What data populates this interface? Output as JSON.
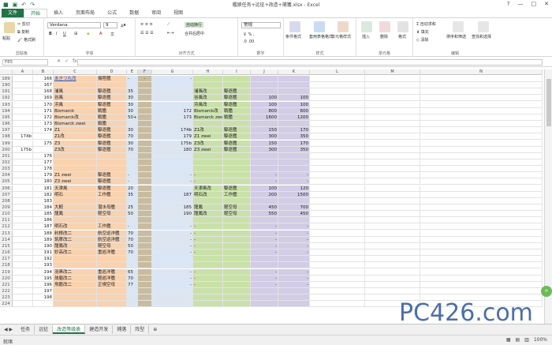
{
  "app": {
    "title": "艦娘任务+远征+改造+捕獲.xlsx - Excel"
  },
  "tabs": [
    "文件",
    "开始",
    "插入",
    "页面布局",
    "公式",
    "数据",
    "审阅",
    "视图"
  ],
  "ribbon": {
    "clipboard": {
      "paste": "粘贴",
      "cut": "剪切",
      "copy": "复制",
      "painter": "格式刷",
      "label": "剪贴板"
    },
    "font": {
      "name": "Verdana",
      "size": "9",
      "label": "字体"
    },
    "align": {
      "wrap": "自动换行",
      "merge": "合并后居中",
      "label": "对齐方式"
    },
    "number": {
      "format": "常规",
      "label": "数字"
    },
    "styles": {
      "cond": "条件格式",
      "table": "套用表格格式",
      "cell": "单元格样式",
      "label": "样式"
    },
    "cells": {
      "insert": "插入",
      "delete": "删除",
      "format": "格式",
      "label": "单元格"
    },
    "edit": {
      "autosum": "自动求和",
      "fill": "填充",
      "clear": "清除",
      "sort": "排序和筛选",
      "find": "查找和选择",
      "label": "编辑"
    }
  },
  "formula": {
    "namebox": "F85",
    "fx": "fx"
  },
  "columns": [
    "",
    "A",
    "B",
    "C",
    "D",
    "E",
    "F",
    "G",
    "H",
    "I",
    "J",
    "K",
    "L",
    "M",
    "N"
  ],
  "rows": [
    {
      "n": "189",
      "a": "",
      "b": "166",
      "c": "あきつ丸改",
      "d": "揚陸艦",
      "e": "-",
      "f": "-",
      "g": "-",
      "h": "",
      "i": "",
      "j": "",
      "k": "",
      "link": true
    },
    {
      "n": "190",
      "a": "",
      "b": "167",
      "c": "",
      "d": "",
      "e": "",
      "f": "",
      "g": "",
      "h": "",
      "i": "",
      "j": "",
      "k": ""
    },
    {
      "n": "191",
      "a": "",
      "b": "168",
      "c": "浦風",
      "d": "駆逐艦",
      "e": "35",
      "f": "",
      "g": "",
      "h": "浦風改",
      "i": "駆逐艦",
      "j": "",
      "k": ""
    },
    {
      "n": "192",
      "a": "",
      "b": "169",
      "c": "谷風",
      "d": "駆逐艦",
      "e": "30",
      "f": "",
      "g": "",
      "h": "谷風改",
      "i": "駆逐艦",
      "j": "100",
      "k": "100"
    },
    {
      "n": "193",
      "a": "",
      "b": "170",
      "c": "浜風",
      "d": "駆逐艦",
      "e": "30",
      "f": "",
      "g": "",
      "h": "浜風改",
      "i": "駆逐艦",
      "j": "100",
      "k": "100"
    },
    {
      "n": "194",
      "a": "",
      "b": "171",
      "c": "Bismarck",
      "d": "戦艦",
      "e": "30",
      "f": "",
      "g": "172",
      "h": "Bismarck改",
      "i": "戦艦",
      "j": "800",
      "k": "600"
    },
    {
      "n": "195",
      "a": "",
      "b": "172",
      "c": "Bismarck改",
      "d": "戦艦",
      "e": "50+",
      "f": "",
      "g": "173",
      "h": "Bismarck zwei",
      "i": "戦艦",
      "j": "1600",
      "k": "1200"
    },
    {
      "n": "196",
      "a": "",
      "b": "173",
      "c": "Bismarck zwei",
      "d": "戦艦",
      "e": "",
      "f": "",
      "g": "",
      "h": "",
      "i": "",
      "j": "",
      "k": ""
    },
    {
      "n": "197",
      "a": "",
      "b": "174",
      "c": "Z1",
      "d": "駆逐艦",
      "e": "30",
      "f": "",
      "g": "174b",
      "h": "Z1改",
      "i": "駆逐艦",
      "j": "150",
      "k": "170"
    },
    {
      "n": "198",
      "a": "174b",
      "b": "",
      "c": "Z1改",
      "d": "駆逐艦",
      "e": "70",
      "f": "",
      "g": "179",
      "h": "Z1 zwei",
      "i": "駆逐艦",
      "j": "300",
      "k": "350"
    },
    {
      "n": "199",
      "a": "",
      "b": "175",
      "c": "Z3",
      "d": "駆逐艦",
      "e": "30",
      "f": "",
      "g": "175b",
      "h": "Z3改",
      "i": "駆逐艦",
      "j": "150",
      "k": "170"
    },
    {
      "n": "200",
      "a": "175b",
      "b": "",
      "c": "Z3改",
      "d": "駆逐艦",
      "e": "70",
      "f": "",
      "g": "180",
      "h": "Z3 zwei",
      "i": "駆逐艦",
      "j": "300",
      "k": "350"
    },
    {
      "n": "201",
      "a": "",
      "b": "176",
      "c": "",
      "d": "",
      "e": "",
      "f": "",
      "g": "",
      "h": "",
      "i": "",
      "j": "",
      "k": ""
    },
    {
      "n": "202",
      "a": "",
      "b": "177",
      "c": "",
      "d": "",
      "e": "",
      "f": "",
      "g": "",
      "h": "",
      "i": "",
      "j": "",
      "k": ""
    },
    {
      "n": "203",
      "a": "",
      "b": "178",
      "c": "",
      "d": "",
      "e": "",
      "f": "",
      "g": "",
      "h": "",
      "i": "",
      "j": "",
      "k": ""
    },
    {
      "n": "204",
      "a": "",
      "b": "179",
      "c": "Z1 zwei",
      "d": "駆逐艦",
      "e": "-",
      "f": "",
      "g": "-",
      "h": "-",
      "i": "",
      "j": "-",
      "k": "-"
    },
    {
      "n": "205",
      "a": "",
      "b": "180",
      "c": "Z3 zwei",
      "d": "駆逐艦",
      "e": "-",
      "f": "",
      "g": "-",
      "h": "-",
      "i": "",
      "j": "-",
      "k": "-"
    },
    {
      "n": "206",
      "a": "",
      "b": "181",
      "c": "天津風",
      "d": "駆逐艦",
      "e": "20",
      "f": "",
      "g": "",
      "h": "天津風改",
      "i": "駆逐艦",
      "j": "100",
      "k": "120"
    },
    {
      "n": "207",
      "a": "",
      "b": "182",
      "c": "明石",
      "d": "工作艦",
      "e": "35",
      "f": "",
      "g": "187",
      "h": "明石改",
      "i": "工作艦",
      "j": "200",
      "k": "1500"
    },
    {
      "n": "208",
      "a": "",
      "b": "183",
      "c": "",
      "d": "",
      "e": "",
      "f": "",
      "g": "",
      "h": "",
      "i": "",
      "j": "",
      "k": ""
    },
    {
      "n": "209",
      "a": "",
      "b": "184",
      "c": "大鯨",
      "d": "潜水母艦",
      "e": "25",
      "f": "",
      "g": "185",
      "h": "龍鳳",
      "i": "軽空母",
      "j": "450",
      "k": "700"
    },
    {
      "n": "210",
      "a": "",
      "b": "185",
      "c": "龍鳳",
      "d": "軽空母",
      "e": "50",
      "f": "",
      "g": "190",
      "h": "龍鳳改",
      "i": "軽空母",
      "j": "550",
      "k": "450"
    },
    {
      "n": "211",
      "a": "",
      "b": "186",
      "c": "",
      "d": "",
      "e": "",
      "f": "",
      "g": "",
      "h": "",
      "i": "",
      "j": "",
      "k": ""
    },
    {
      "n": "212",
      "a": "",
      "b": "187",
      "c": "明石改",
      "d": "工作艦",
      "e": "-",
      "f": "",
      "g": "-",
      "h": "-",
      "i": "",
      "j": "-",
      "k": "-"
    },
    {
      "n": "213",
      "a": "",
      "b": "188",
      "c": "利根改二",
      "d": "航空巡洋艦",
      "e": "70",
      "f": "",
      "g": "-",
      "h": "-",
      "i": "",
      "j": "-",
      "k": "-"
    },
    {
      "n": "214",
      "a": "",
      "b": "189",
      "c": "筑摩改二",
      "d": "航空巡洋艦",
      "e": "70",
      "f": "",
      "g": "-",
      "h": "-",
      "i": "",
      "j": "-",
      "k": "-"
    },
    {
      "n": "215",
      "a": "",
      "b": "190",
      "c": "龍鳳改",
      "d": "軽空母",
      "e": "50",
      "f": "",
      "g": "-",
      "h": "-",
      "i": "",
      "j": "-",
      "k": "-"
    },
    {
      "n": "216",
      "a": "",
      "b": "191",
      "c": "妙高改二",
      "d": "重巡洋艦",
      "e": "70",
      "f": "",
      "g": "-",
      "h": "-",
      "i": "",
      "j": "-",
      "k": "-"
    },
    {
      "n": "217",
      "a": "",
      "b": "192",
      "c": "",
      "d": "",
      "e": "",
      "f": "",
      "g": "",
      "h": "",
      "i": "",
      "j": "",
      "k": ""
    },
    {
      "n": "218",
      "a": "",
      "b": "193",
      "c": "",
      "d": "",
      "e": "",
      "f": "",
      "g": "",
      "h": "",
      "i": "",
      "j": "",
      "k": ""
    },
    {
      "n": "219",
      "a": "",
      "b": "194",
      "c": "羽黒改二",
      "d": "重巡洋艦",
      "e": "65",
      "f": "",
      "g": "-",
      "h": "-",
      "i": "",
      "j": "-",
      "k": "-"
    },
    {
      "n": "220",
      "a": "",
      "b": "195",
      "c": "球磨改二",
      "d": "軽巡洋艦",
      "e": "70",
      "f": "",
      "g": "-",
      "h": "-",
      "i": "",
      "j": "-",
      "k": "-"
    },
    {
      "n": "221",
      "a": "",
      "b": "196",
      "c": "飛龍改二",
      "d": "正規空母",
      "e": "77",
      "f": "",
      "g": "-",
      "h": "-",
      "i": "",
      "j": "-",
      "k": "-"
    },
    {
      "n": "222",
      "a": "",
      "b": "197",
      "c": "",
      "d": "",
      "e": "",
      "f": "",
      "g": "",
      "h": "",
      "i": "",
      "j": "",
      "k": ""
    },
    {
      "n": "223",
      "a": "",
      "b": "198",
      "c": "",
      "d": "",
      "e": "",
      "f": "",
      "g": "",
      "h": "",
      "i": "",
      "j": "",
      "k": ""
    },
    {
      "n": "224",
      "a": "",
      "b": "",
      "c": "",
      "d": "",
      "e": "",
      "f": "",
      "g": "",
      "h": "",
      "i": "",
      "j": "",
      "k": ""
    }
  ],
  "sheets": [
    "任务",
    "远征",
    "改造等级表",
    "建造开发",
    "捕落",
    "阵型"
  ],
  "status": {
    "ready": "就绪",
    "zoom": "100%"
  },
  "watermark": "PC426.com",
  "colors": {
    "orange": "#f9d2b0",
    "green": "#c9e1a8",
    "purple": "#d2cce6",
    "tan": "#c8bca0",
    "blue": "#dbe6f5"
  }
}
